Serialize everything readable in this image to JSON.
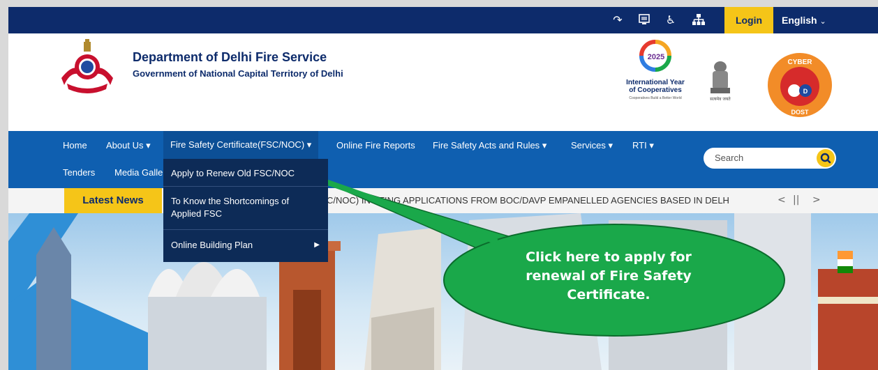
{
  "topbar": {
    "icons": [
      "skip-to-content-icon",
      "screen-reader-icon",
      "accessibility-icon",
      "sitemap-icon"
    ],
    "login_label": "Login",
    "language_label": "English",
    "color": "#0d2b6b",
    "accent": "#f5c518"
  },
  "header": {
    "title": "Department of Delhi Fire Service",
    "subtitle": "Government of National Capital Territory of Delhi",
    "iyc_year": "2025",
    "iyc_line1": "International Year",
    "iyc_line2": "of Cooperatives",
    "iyc_tagline": "Cooperatives Build a Better World",
    "emblem_caption": "सत्यमेव जयते",
    "cyber_top": "CYBER",
    "cyber_mid": "D",
    "cyber_bottom": "DOST"
  },
  "nav": {
    "color": "#0f5fb0",
    "items": [
      {
        "label": "Home"
      },
      {
        "label": "About Us"
      },
      {
        "label": "Fire Safety Certificate(FSC/NOC)"
      },
      {
        "label": "Online Fire Reports"
      },
      {
        "label": "Fire Safety Acts and Rules"
      },
      {
        "label": "Services"
      },
      {
        "label": "RTI"
      },
      {
        "label": "Tenders"
      },
      {
        "label": "Media Galle"
      }
    ],
    "search_placeholder": "Search"
  },
  "dropdown": {
    "items": [
      {
        "label": "Apply to Renew Old FSC/NOC"
      },
      {
        "label": "To Know the Shortcomings of Applied FSC"
      },
      {
        "label": "Online Building Plan"
      }
    ]
  },
  "ticker": {
    "label": "Latest News",
    "text": "C/NOC)      INVITING APPLICATIONS FROM BOC/DAVP EMPANELLED AGENCIES BASED IN DELH",
    "prev": "<",
    "pause": "||",
    "next": ">"
  },
  "callout": {
    "line1": "Click here to apply for",
    "line2": "renewal of Fire Safety",
    "line3": "Certificate.",
    "color": "#1aa84a"
  }
}
